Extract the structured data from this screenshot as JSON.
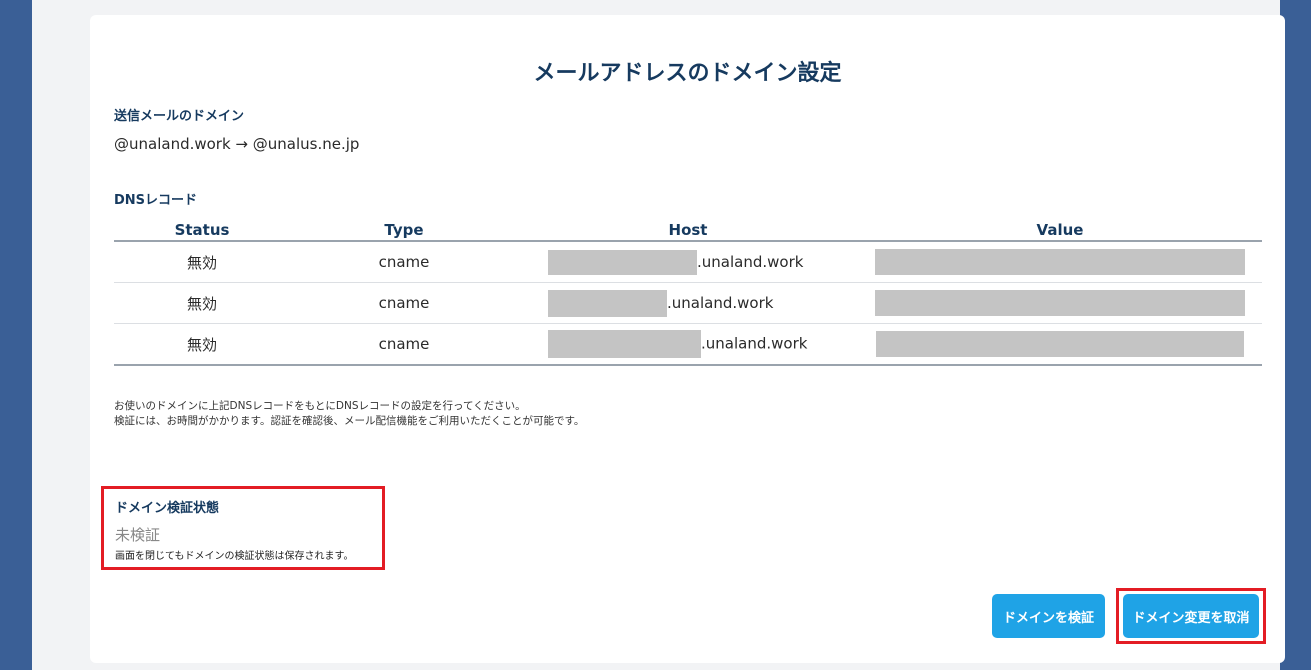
{
  "page": {
    "title": "メールアドレスのドメイン設定"
  },
  "sender": {
    "label": "送信メールのドメイン",
    "value": "@unaland.work → @unalus.ne.jp"
  },
  "dns": {
    "label": "DNSレコード",
    "headers": [
      "Status",
      "Type",
      "Host",
      "Value"
    ],
    "rows": [
      {
        "status": "無効",
        "type": "cname",
        "host_suffix": ".unaland.work"
      },
      {
        "status": "無効",
        "type": "cname",
        "host_suffix": ".unaland.work"
      },
      {
        "status": "無効",
        "type": "cname",
        "host_suffix": ".unaland.work"
      }
    ]
  },
  "instructions": {
    "line1": "お使いのドメインに上記DNSレコードをもとにDNSレコードの設定を行ってください。",
    "line2": "検証には、お時間がかかります。認証を確認後、メール配信機能をご利用いただくことが可能です。"
  },
  "verification": {
    "title": "ドメイン検証状態",
    "status": "未検証",
    "note": "画面を閉じてもドメインの検証状態は保存されます。"
  },
  "buttons": {
    "verify": "ドメインを検証",
    "cancel": "ドメイン変更を取消"
  },
  "colors": {
    "accent": "#1fa3e6",
    "heading": "#163a5f",
    "highlight": "#e31c24",
    "background": "#3a5f96"
  }
}
